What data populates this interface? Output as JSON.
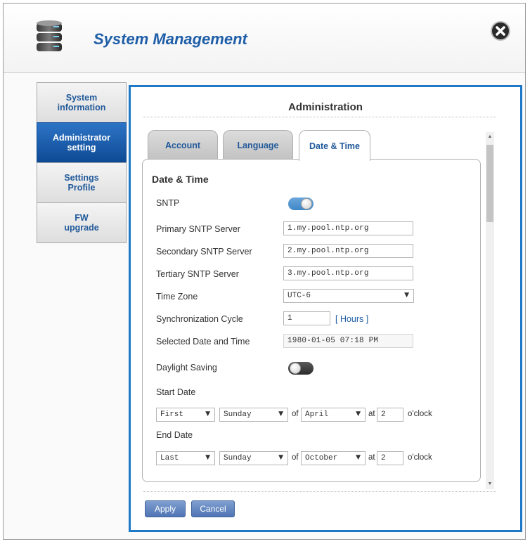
{
  "header": {
    "title": "System Management",
    "icon": "database-icon",
    "close_icon": "close-icon"
  },
  "sidebar": {
    "items": [
      {
        "label": "System\ninformation",
        "active": false
      },
      {
        "label": "Administrator\nsetting",
        "active": true
      },
      {
        "label": "Settings\nProfile",
        "active": false
      },
      {
        "label": "FW\nupgrade",
        "active": false
      }
    ]
  },
  "panel": {
    "title": "Administration",
    "tabs": [
      {
        "label": "Account",
        "active": false
      },
      {
        "label": "Language",
        "active": false
      },
      {
        "label": "Date & Time",
        "active": true
      }
    ]
  },
  "datetime": {
    "section_title": "Date & Time",
    "sntp": {
      "label": "SNTP",
      "enabled": true
    },
    "primary": {
      "label": "Primary SNTP Server",
      "value": "1.my.pool.ntp.org"
    },
    "secondary": {
      "label": "Secondary SNTP Server",
      "value": "2.my.pool.ntp.org"
    },
    "tertiary": {
      "label": "Tertiary SNTP Server",
      "value": "3.my.pool.ntp.org"
    },
    "timezone": {
      "label": "Time Zone",
      "value": "UTC-6"
    },
    "sync_cycle": {
      "label": "Synchronization Cycle",
      "value": "1",
      "unit": "[ Hours ]"
    },
    "selected_datetime": {
      "label": "Selected Date and Time",
      "value": "1980-01-05 07:18 PM"
    },
    "daylight": {
      "label": "Daylight Saving",
      "enabled": false
    },
    "start_date": {
      "label": "Start Date",
      "week": "First",
      "day": "Sunday",
      "of": "of",
      "month": "April",
      "at": "at",
      "hour": "2",
      "oclock": "o'clock"
    },
    "end_date": {
      "label": "End Date",
      "week": "Last",
      "day": "Sunday",
      "of": "of",
      "month": "October",
      "at": "at",
      "hour": "2",
      "oclock": "o'clock"
    }
  },
  "buttons": {
    "apply": "Apply",
    "cancel": "Cancel"
  },
  "colors": {
    "accent": "#1e78c8",
    "title_blue": "#1f5ea8",
    "active_nav": "#0e4a94"
  }
}
